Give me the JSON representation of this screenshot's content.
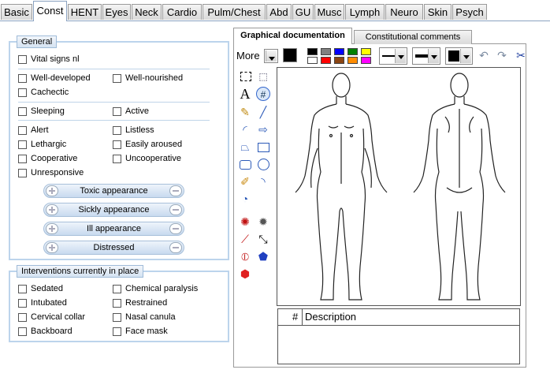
{
  "tabs": [
    "Basic",
    "Const",
    "HENT",
    "Eyes",
    "Neck",
    "Cardio",
    "Pulm/Chest",
    "Abd",
    "GU",
    "Musc",
    "Lymph",
    "Neuro",
    "Skin",
    "Psych"
  ],
  "general": {
    "legend": "General",
    "vital": "Vital signs nl",
    "well_developed": "Well-developed",
    "well_nourished": "Well-nourished",
    "cachectic": "Cachectic",
    "sleeping": "Sleeping",
    "active": "Active",
    "alert": "Alert",
    "listless": "Listless",
    "lethargic": "Lethargic",
    "easily_aroused": "Easily aroused",
    "cooperative": "Cooperative",
    "uncooperative": "Uncooperative",
    "unresponsive": "Unresponsive",
    "pills": [
      "Toxic appearance",
      "Sickly appearance",
      "Ill appearance",
      "Distressed"
    ]
  },
  "interventions": {
    "legend": "Interventions currently in place",
    "sedated": "Sedated",
    "chemical_paralysis": "Chemical paralysis",
    "intubated": "Intubated",
    "restrained": "Restrained",
    "cervical_collar": "Cervical collar",
    "nasal_canula": "Nasal canula",
    "backboard": "Backboard",
    "face_mask": "Face mask"
  },
  "graphical": {
    "tab_active": "Graphical documentation",
    "tab_other": "Constitutional comments",
    "more": "More",
    "text_tool": "A",
    "hash_tool": "#",
    "table_hash": "#",
    "table_desc": "Description",
    "palette": [
      "#000000",
      "#808080",
      "#0000ff",
      "#008000",
      "#ffff00",
      "#ffffff",
      "#ff0000",
      "#8b4513",
      "#ff8c00",
      "#ff00ff"
    ]
  }
}
